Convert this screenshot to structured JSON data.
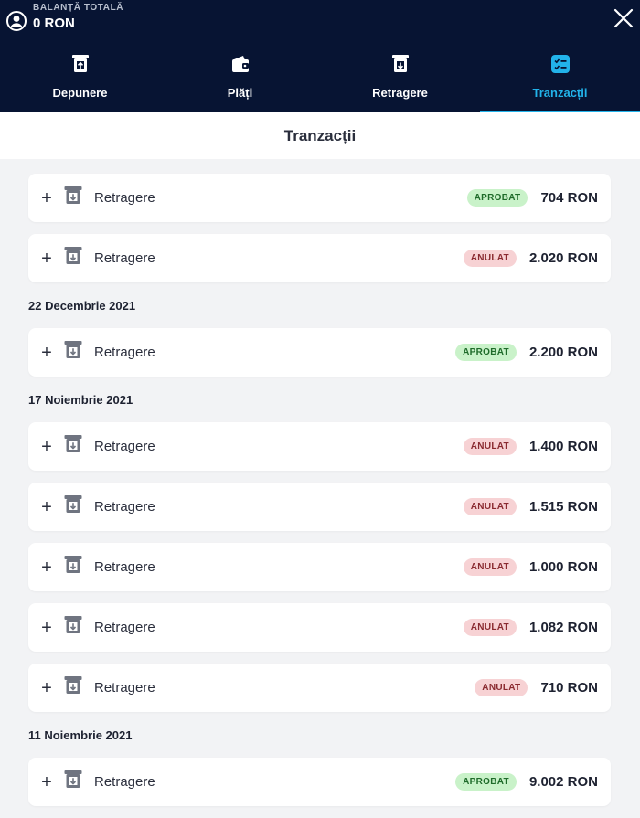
{
  "header": {
    "balance_label": "BALANȚĂ TOTALĂ",
    "balance_value": "0 RON"
  },
  "tabs": [
    {
      "label": "Depunere",
      "icon": "deposit-icon",
      "active": false
    },
    {
      "label": "Plăți",
      "icon": "wallet-icon",
      "active": false
    },
    {
      "label": "Retragere",
      "icon": "withdraw-icon",
      "active": false
    },
    {
      "label": "Tranzacții",
      "icon": "checklist-icon",
      "active": true
    }
  ],
  "page": {
    "title": "Tranzacții"
  },
  "colors": {
    "accent": "#22b3ea",
    "topbar": "#071433",
    "approved_bg": "#c9f2c9",
    "cancelled_bg": "#f7d2d4"
  },
  "groups": [
    {
      "date": "",
      "transactions": [
        {
          "type": "Retragere",
          "status": "APROBAT",
          "status_kind": "approved",
          "amount": "704 RON"
        },
        {
          "type": "Retragere",
          "status": "ANULAT",
          "status_kind": "cancelled",
          "amount": "2.020 RON"
        }
      ]
    },
    {
      "date": "22 Decembrie 2021",
      "transactions": [
        {
          "type": "Retragere",
          "status": "APROBAT",
          "status_kind": "approved",
          "amount": "2.200 RON"
        }
      ]
    },
    {
      "date": "17 Noiembrie 2021",
      "transactions": [
        {
          "type": "Retragere",
          "status": "ANULAT",
          "status_kind": "cancelled",
          "amount": "1.400 RON"
        },
        {
          "type": "Retragere",
          "status": "ANULAT",
          "status_kind": "cancelled",
          "amount": "1.515 RON"
        },
        {
          "type": "Retragere",
          "status": "ANULAT",
          "status_kind": "cancelled",
          "amount": "1.000 RON"
        },
        {
          "type": "Retragere",
          "status": "ANULAT",
          "status_kind": "cancelled",
          "amount": "1.082 RON"
        },
        {
          "type": "Retragere",
          "status": "ANULAT",
          "status_kind": "cancelled",
          "amount": "710 RON"
        }
      ]
    },
    {
      "date": "11 Noiembrie 2021",
      "transactions": [
        {
          "type": "Retragere",
          "status": "APROBAT",
          "status_kind": "approved",
          "amount": "9.002 RON"
        }
      ]
    }
  ]
}
